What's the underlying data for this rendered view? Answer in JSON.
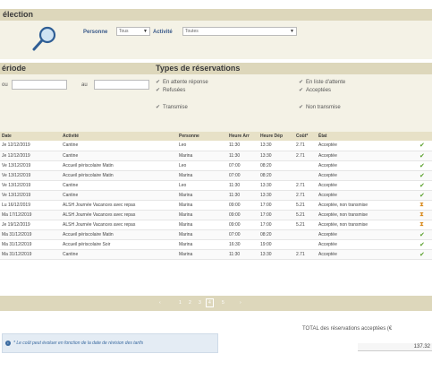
{
  "selection": {
    "title": "élection",
    "personne_label": "Personne",
    "personne_value": "Tous",
    "activite_label": "Activité",
    "activite_value": "Toutes"
  },
  "periode": {
    "title": "ériode",
    "from_label": "ou",
    "to_label": "au"
  },
  "types": {
    "title": "Types de réservations",
    "left": [
      "En attente réponse",
      "Refusées",
      "Transmise"
    ],
    "right": [
      "En liste d'attente",
      "Acceptées",
      "Non transmise"
    ]
  },
  "table": {
    "columns": [
      "Date",
      "Activité",
      "Personne",
      "Heure Arr",
      "Heure Dép",
      "Coût*",
      "État"
    ],
    "rows": [
      [
        "Je 12/12/2019",
        "Cantine",
        "Leo",
        "11:30",
        "13:30",
        "2.71",
        "Acceptée",
        "ok"
      ],
      [
        "Je 12/12/2019",
        "Cantine",
        "Marina",
        "11:30",
        "13:30",
        "2.71",
        "Acceptée",
        "ok"
      ],
      [
        "Ve 13/12/2019",
        "Accueil périscolaire Matin",
        "Leo",
        "07:00",
        "08:20",
        "",
        "Acceptée",
        "ok"
      ],
      [
        "Ve 13/12/2019",
        "Accueil périscolaire Matin",
        "Marina",
        "07:00",
        "08:20",
        "",
        "Acceptée",
        "ok"
      ],
      [
        "Ve 13/12/2019",
        "Cantine",
        "Leo",
        "11:30",
        "13:30",
        "2.71",
        "Acceptée",
        "ok"
      ],
      [
        "Ve 13/12/2019",
        "Cantine",
        "Marina",
        "11:30",
        "13:30",
        "2.71",
        "Acceptée",
        "ok"
      ],
      [
        "Lu 16/12/2019",
        "ALSH Journée Vacances avec repas",
        "Marina",
        "09:00",
        "17:00",
        "5.21",
        "Acceptée, non transmise",
        "wait"
      ],
      [
        "Ma 17/12/2019",
        "ALSH Journée Vacances avec repas",
        "Marina",
        "09:00",
        "17:00",
        "5.21",
        "Acceptée, non transmise",
        "wait"
      ],
      [
        "Je 19/12/2019",
        "ALSH Journée Vacances avec repas",
        "Marina",
        "09:00",
        "17:00",
        "5.21",
        "Acceptée, non transmise",
        "wait"
      ],
      [
        "Ma 31/12/2019",
        "Accueil périscolaire Matin",
        "Marina",
        "07:00",
        "08:20",
        "",
        "Acceptée",
        "ok"
      ],
      [
        "Ma 31/12/2019",
        "Accueil périscolaire Soir",
        "Marina",
        "16:30",
        "19:00",
        "",
        "Acceptée",
        "ok"
      ],
      [
        "Ma 31/12/2019",
        "Cantine",
        "Marina",
        "11:30",
        "13:30",
        "2.71",
        "Acceptée",
        "ok"
      ]
    ]
  },
  "pager": {
    "prev": "‹",
    "pages": [
      "1",
      "2",
      "3",
      "4",
      "5"
    ],
    "current": "4",
    "next": "›"
  },
  "note": "* Le coût peut évoluer en fonction de la date de révision des tarifs",
  "total": {
    "label": "TOTAL des réservations acceptées (€",
    "value": "137.32"
  }
}
